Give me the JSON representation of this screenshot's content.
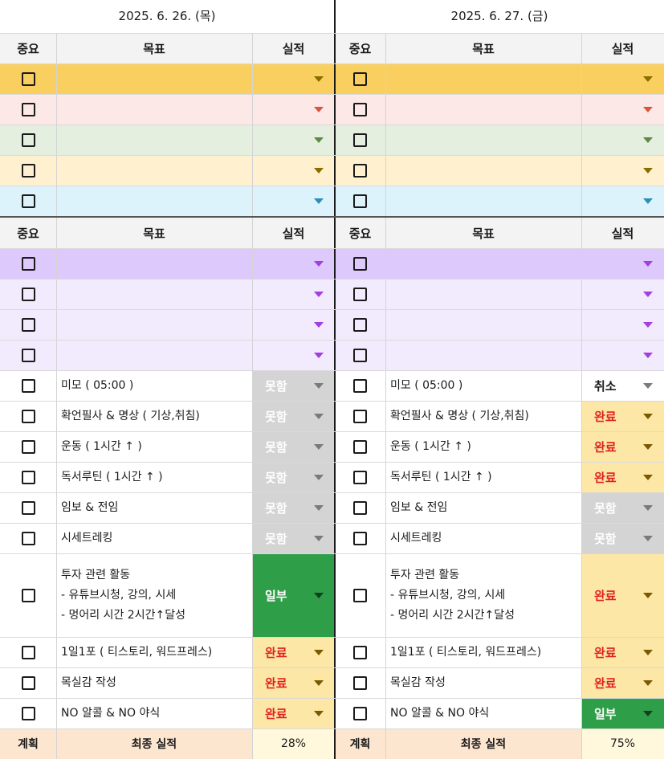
{
  "days": [
    {
      "date": "2025. 6. 26. (목)",
      "summary": {
        "plan": "계획",
        "final": "최종 실적",
        "percent": "28%"
      }
    },
    {
      "date": "2025. 6. 27. (금)",
      "summary": {
        "plan": "계획",
        "final": "최종 실적",
        "percent": "75%"
      }
    }
  ],
  "headers": {
    "important": "중요",
    "goal": "목표",
    "result": "실적"
  },
  "colors": {
    "gold": "#f9cf5f",
    "pink": "#fde8e8",
    "green": "#e4efdf",
    "cream": "#fff1cf",
    "cyan": "#dcf3fb",
    "purple_strong": "#dec9fd",
    "purple_light": "#f2eafd",
    "status_none": "#d4d4d4",
    "status_done": "#fde7a6",
    "status_partial": "#2e9e48",
    "footer": "#fde6d0"
  },
  "goals": [
    {
      "lines": [
        "미모 ( 05:00 )"
      ]
    },
    {
      "lines": [
        "확언필사 & 명상 ( 기상,취침)"
      ]
    },
    {
      "lines": [
        "운동 ( 1시간 ↑ )"
      ]
    },
    {
      "lines": [
        "독서루틴 ( 1시간 ↑ )"
      ]
    },
    {
      "lines": [
        "임보 & 전임"
      ]
    },
    {
      "lines": [
        "시세트레킹"
      ]
    },
    {
      "lines": [
        "투자 관련 활동",
        " - 유튜브시청, 강의, 시세",
        " - 멍어리 시간 2시간↑달성"
      ]
    },
    {
      "lines": [
        "1일1포 ( 티스토리, 워드프레스)"
      ]
    },
    {
      "lines": [
        "목실감 작성"
      ]
    },
    {
      "lines": [
        "NO 알콜 & NO 야식"
      ]
    }
  ],
  "results": [
    [
      "못함",
      "취소"
    ],
    [
      "못함",
      "완료"
    ],
    [
      "못함",
      "완료"
    ],
    [
      "못함",
      "완료"
    ],
    [
      "못함",
      "못함"
    ],
    [
      "못함",
      "못함"
    ],
    [
      "일부",
      "완료"
    ],
    [
      "완료",
      "완료"
    ],
    [
      "완료",
      "완료"
    ],
    [
      "완료",
      "일부"
    ]
  ]
}
